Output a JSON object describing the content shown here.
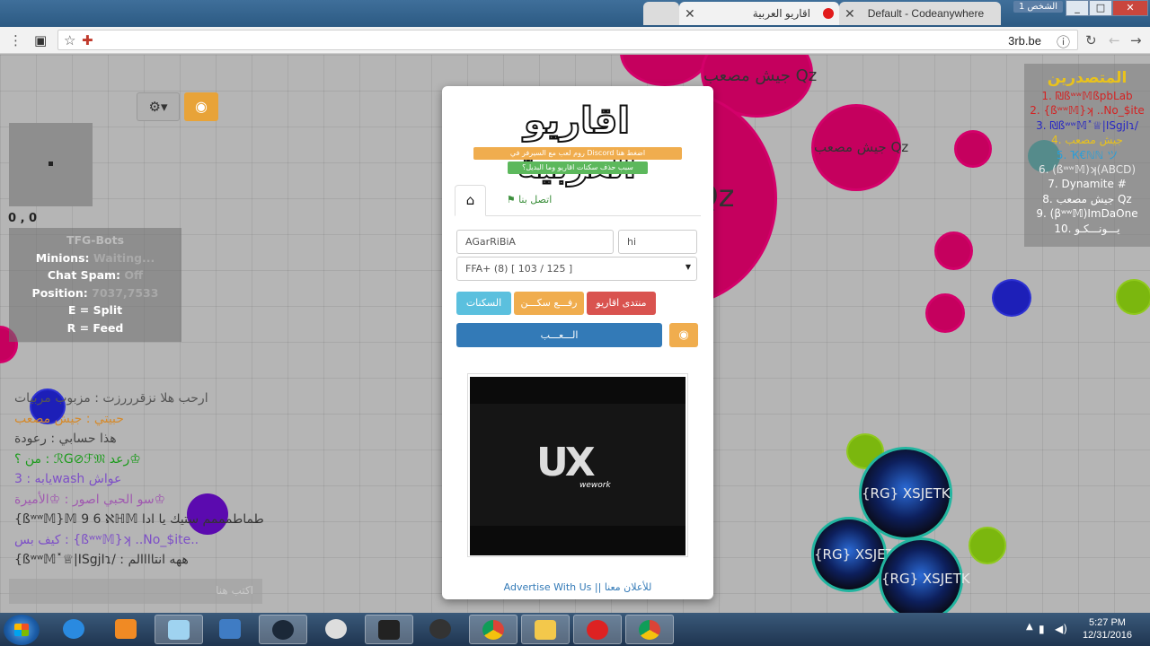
{
  "browser": {
    "tabs": [
      {
        "title": "اقاريو العربية",
        "active": true
      },
      {
        "title": "Default - Codeanywhere",
        "active": false
      }
    ],
    "profile": "الشخص 1",
    "url": "3rb.be",
    "window_controls": {
      "minimize": "_",
      "maximize": "□",
      "close": "✕"
    }
  },
  "game": {
    "coords": "0 , 0",
    "bot_panel": {
      "title": "TFG-Bots",
      "minions_label": "Minions:",
      "minions_value": "Waiting...",
      "chatspam_label": "Chat Spam:",
      "chatspam_value": "Off",
      "position_label": "Position:",
      "position_value": "7037,7533",
      "split_help": "E = Split",
      "feed_help": "R = Feed"
    },
    "chat": [
      {
        "text": "ارحب هلا نزقرررزت  :  مزبوب مربيات",
        "color": "#555"
      },
      {
        "text": "حبيتي  :  جيش مصعب",
        "color": "#d58a2b"
      },
      {
        "text": "هذا حسابي  :    رعودة",
        "color": "#444"
      },
      {
        "text": "من ؟  :  ℛG⊘ℱ𝔐 رعد♔",
        "color": "#1c9b1c"
      },
      {
        "text": "يابه  :  3wash  عواش",
        "color": "#7d4fc7"
      },
      {
        "text": "سو الحبي اصور  :  ♔الأميرة♔",
        "color": "#a05ab0"
      },
      {
        "text": "{ßʷʷ𝕄}𝕄  9  6  ℵℍ𝕄  طماطمممم ستيك يا ادا",
        "color": "#333"
      },
      {
        "text": "كيف بس  :  {ßʷʷ𝕄}ʞ  ..No_$ite..",
        "color": "#7d4fc7"
      },
      {
        "text": "{ßʷʷ𝕄˟♕|ISgjIɿ/  :  ههه انتاااالم",
        "color": "#333"
      }
    ],
    "chat_placeholder": "اكتب هنا",
    "leaderboard": {
      "title": "المتصدرين",
      "entries": [
        {
          "text": "1. ₪ßʷʷ𝕄ßpbLab",
          "color": "#d42323"
        },
        {
          "text": "2. {ßʷʷ𝕄}ʞ ..No_$ite",
          "color": "#d42323"
        },
        {
          "text": "3. ₪ßʷʷ𝕄˟♕|ISgjIɿ/",
          "color": "#2727c4"
        },
        {
          "text": "4. جيش مصعب",
          "color": "#e9c21c"
        },
        {
          "text": "5. Ҡ€ℕℕ ツ",
          "color": "#2a9ed8"
        },
        {
          "text": "6. (ßʷʷ𝕄)ʞ(ABCD)",
          "color": "#e8e8e8"
        },
        {
          "text": "7. Dynamite #",
          "color": "#f2f2f2"
        },
        {
          "text": "8. جيش مصعب Qz",
          "color": "#f2f2f2"
        },
        {
          "text": "9. (βʷʷ𝕄)ImDaOne",
          "color": "#f2f2f2"
        },
        {
          "text": "10. يـــونـــكـو",
          "color": "#f2f2f2"
        }
      ]
    },
    "cells": {
      "big_name": "جيش Qz",
      "mid_name": "جيش مصعب Qz",
      "small_name": "جيش مصعب Qz",
      "rg_name": "{RG} XSJETK",
      "rg_name_small": "{RG} XSJETK",
      "rg_name_3": "{RG} XSJETK"
    }
  },
  "modal": {
    "logo": "اقاريو العربية",
    "promo1": "روم لعب مع السيرفر في Discord اضغط هنا",
    "promo2": "سبب حذف سكنات اقاريو وما البديل؟",
    "tab_home_icon": "⌂",
    "tab_contact": "اتصل بنا",
    "nick_value": "AGarRiBiA",
    "tag_value": "hi",
    "server_value": "FFA+ (8) [ 103 / 125 ]",
    "btn_skins": "السكنات",
    "btn_upload": "رفـــع سكـــن",
    "btn_forum": "منتدى اقاريو",
    "btn_play": "الـــعـــب",
    "btn_spectate_icon": "◉",
    "ad_logo": "UX",
    "ad_sub": "wework",
    "ad_link": "Advertise With Us || للأعلان معنا"
  },
  "taskbar": {
    "time": "5:27 PM",
    "date": "12/31/2016"
  }
}
